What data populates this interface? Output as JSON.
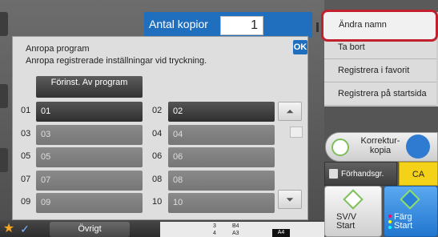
{
  "copies": {
    "label": "Antal kopior",
    "value": "1"
  },
  "dialog": {
    "title": "Anropa program",
    "description": "Anropa registrerade inställningar vid tryckning.",
    "ok_label": "OK",
    "preset_label": "Förinst. Av program",
    "slots": [
      {
        "num": "01",
        "label": "01",
        "filled": true
      },
      {
        "num": "02",
        "label": "02",
        "filled": true
      },
      {
        "num": "03",
        "label": "03",
        "filled": false
      },
      {
        "num": "04",
        "label": "04",
        "filled": false
      },
      {
        "num": "05",
        "label": "05",
        "filled": false
      },
      {
        "num": "06",
        "label": "06",
        "filled": false
      },
      {
        "num": "07",
        "label": "07",
        "filled": false
      },
      {
        "num": "08",
        "label": "08",
        "filled": false
      },
      {
        "num": "09",
        "label": "09",
        "filled": false
      },
      {
        "num": "10",
        "label": "10",
        "filled": false
      }
    ],
    "scroll_up_icon": "double-chevron-up-icon",
    "scroll_down_icon": "double-chevron-down-icon"
  },
  "menu": {
    "items": [
      "Ändra namn",
      "Ta bort",
      "Registrera i favorit",
      "Registrera på startsida"
    ],
    "highlight_color": "#c0212c"
  },
  "controls": {
    "proof_label": "Korrektur-\nkopia",
    "preview_label": "Förhandsgr.",
    "ca_label": "CA",
    "bw_start_label": "SV/V\nStart",
    "color_start_label": "Färg\nStart"
  },
  "bottom": {
    "other_label": "Övrigt",
    "tray_left": [
      "3",
      "4"
    ],
    "tray_right": [
      "B4",
      "A3"
    ],
    "paper_label": "A4"
  },
  "colors": {
    "accent": "#1f6fbe",
    "ca": "#f5d21a",
    "start_green": "#7dbf5a"
  }
}
